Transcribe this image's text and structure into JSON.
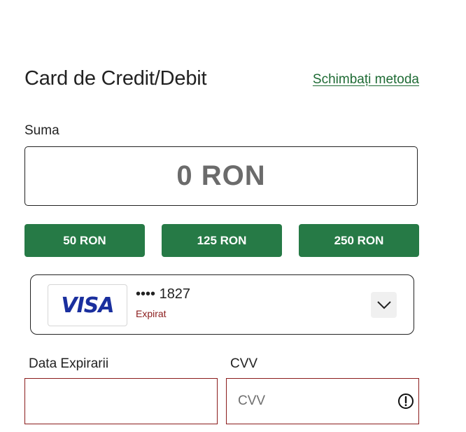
{
  "header": {
    "title": "Card de Credit/Debit",
    "change_method": "Schimbați metoda"
  },
  "amount": {
    "label": "Suma",
    "value": "0 RON"
  },
  "quick_amounts": [
    "50 RON",
    "125 RON",
    "250 RON"
  ],
  "saved_card": {
    "brand": "VISA",
    "number": "•••• 1827",
    "status": "Expirat"
  },
  "expiry": {
    "label": "Data Expirarii",
    "value": ""
  },
  "cvv": {
    "label": "CVV",
    "placeholder": "CVV"
  },
  "colors": {
    "accent_green": "#267a46",
    "link_green": "#1e6b34",
    "error_red": "#8b1c1c",
    "visa_blue": "#1a2f9e"
  }
}
